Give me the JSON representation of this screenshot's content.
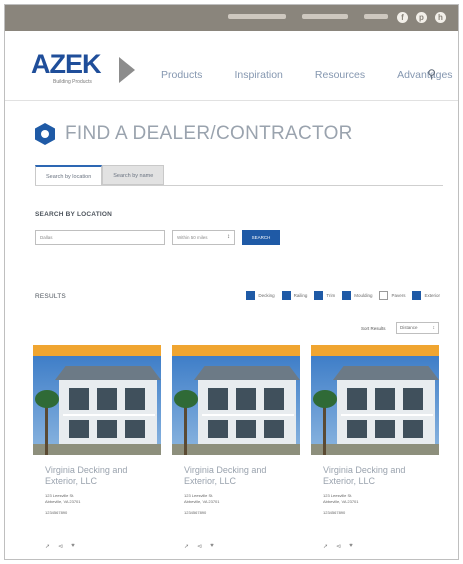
{
  "social": {
    "icons": [
      "facebook-icon",
      "pinterest-icon",
      "houzz-icon"
    ],
    "glyphs": [
      "f",
      "p",
      "h"
    ]
  },
  "brand": {
    "name": "AZEK",
    "tagline": "Building Products"
  },
  "nav": {
    "items": [
      "Products",
      "Inspiration",
      "Resources",
      "Advantages"
    ]
  },
  "page": {
    "title": "FIND A DEALER/CONTRACTOR"
  },
  "tabs": [
    {
      "label": "Search by location"
    },
    {
      "label": "Search by name"
    }
  ],
  "search": {
    "section_label": "SEARCH BY LOCATION",
    "location_value": "Dallas",
    "distance_value": "Within 50 miles",
    "submit_label": "SEARCH"
  },
  "results": {
    "label": "RESULTS",
    "sort_label": "Sort Results",
    "sort_value": "Distance",
    "filters": [
      {
        "label": "Decking",
        "checked": true
      },
      {
        "label": "Railing",
        "checked": true
      },
      {
        "label": "Trim",
        "checked": true
      },
      {
        "label": "Moulding",
        "checked": true
      },
      {
        "label": "Pavers",
        "checked": false
      },
      {
        "label": "Exterior",
        "checked": true
      }
    ]
  },
  "cards": [
    {
      "name": "Virginia Decking and Exterior, LLC",
      "address_line1": "123 Leesville St.",
      "address_line2": "Abbeville, VA 23701",
      "phone": "1234567890"
    },
    {
      "name": "Virginia Decking and Exterior, LLC",
      "address_line1": "123 Leesville St.",
      "address_line2": "Abbeville, VA 23701",
      "phone": "1234567890"
    },
    {
      "name": "Virginia Decking and Exterior, LLC",
      "address_line1": "123 Leesville St.",
      "address_line2": "Abbeville, VA 23701",
      "phone": "1234567890"
    }
  ],
  "colors": {
    "brand_blue": "#1f5aa6",
    "badge_orange": "#f0a530",
    "topbar": "#8a857c"
  }
}
